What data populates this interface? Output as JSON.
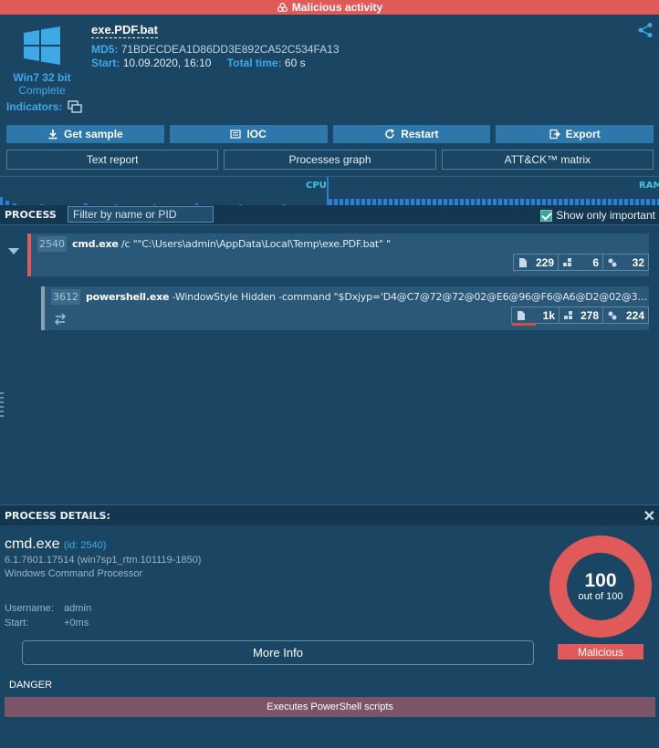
{
  "banner": {
    "text": "Malicious activity"
  },
  "header": {
    "filename": "exe.PDF.bat",
    "md5_label": "MD5:",
    "md5_value": "71BDECDEA1D86DD3E892CA52C534FA13",
    "start_label": "Start:",
    "start_value": "10.09.2020, 16:10",
    "total_label": "Total time:",
    "total_value": "60 s",
    "os_name": "Win7 32 bit",
    "os_status": "Complete",
    "indicators_label": "Indicators:"
  },
  "actions": {
    "get_sample": "Get sample",
    "ioc": "IOC",
    "restart": "Restart",
    "export": "Export",
    "text_report": "Text report",
    "processes_graph": "Processes graph",
    "attck_matrix": "ATT&CK™ matrix"
  },
  "graph": {
    "cpu_label": "CPU",
    "ram_label": "RAM"
  },
  "process_panel": {
    "title": "PROCESS",
    "filter_placeholder": "Filter by name or PID",
    "only_important_label": "Show only important",
    "only_important_checked": true
  },
  "processes": [
    {
      "pid": "2540",
      "name": "cmd.exe",
      "args": " /c \"\"C:\\Users\\admin\\AppData\\Local\\Temp\\exe.PDF.bat\" \"",
      "files": "229",
      "registry": "6",
      "modules": "32",
      "files_fill": 0.02,
      "status_color": "#e05a5a"
    },
    {
      "pid": "3612",
      "name": "powershell.exe",
      "args": " -WindowStyle Hidden -command \"$Dxjyp='D4@C7@72@72@02@E6@96@F6@A6@D2@02@37...",
      "files": "1k",
      "registry": "278",
      "modules": "224",
      "files_fill": 0.5,
      "status_color": "#8aa0b0"
    }
  ],
  "details": {
    "title": "PROCESS DETAILS:",
    "name": "cmd.exe",
    "id_text": "(id: 2540)",
    "version": "6.1.7601.17514 (win7sp1_rtm.101119-1850)",
    "description": "Windows Command Processor",
    "username_label": "Username:",
    "username_value": "admin",
    "start_label": "Start:",
    "start_value": "+0ms",
    "more_info": "More Info",
    "score": "100",
    "score_out_of": "out of 100",
    "verdict": "Malicious",
    "danger_label": "DANGER",
    "danger_items": [
      "Executes PowerShell scripts"
    ]
  },
  "colors": {
    "background": "#1a4663",
    "malicious": "#e05a5a",
    "accent": "#3fa9e8",
    "button": "#2d77ab"
  }
}
